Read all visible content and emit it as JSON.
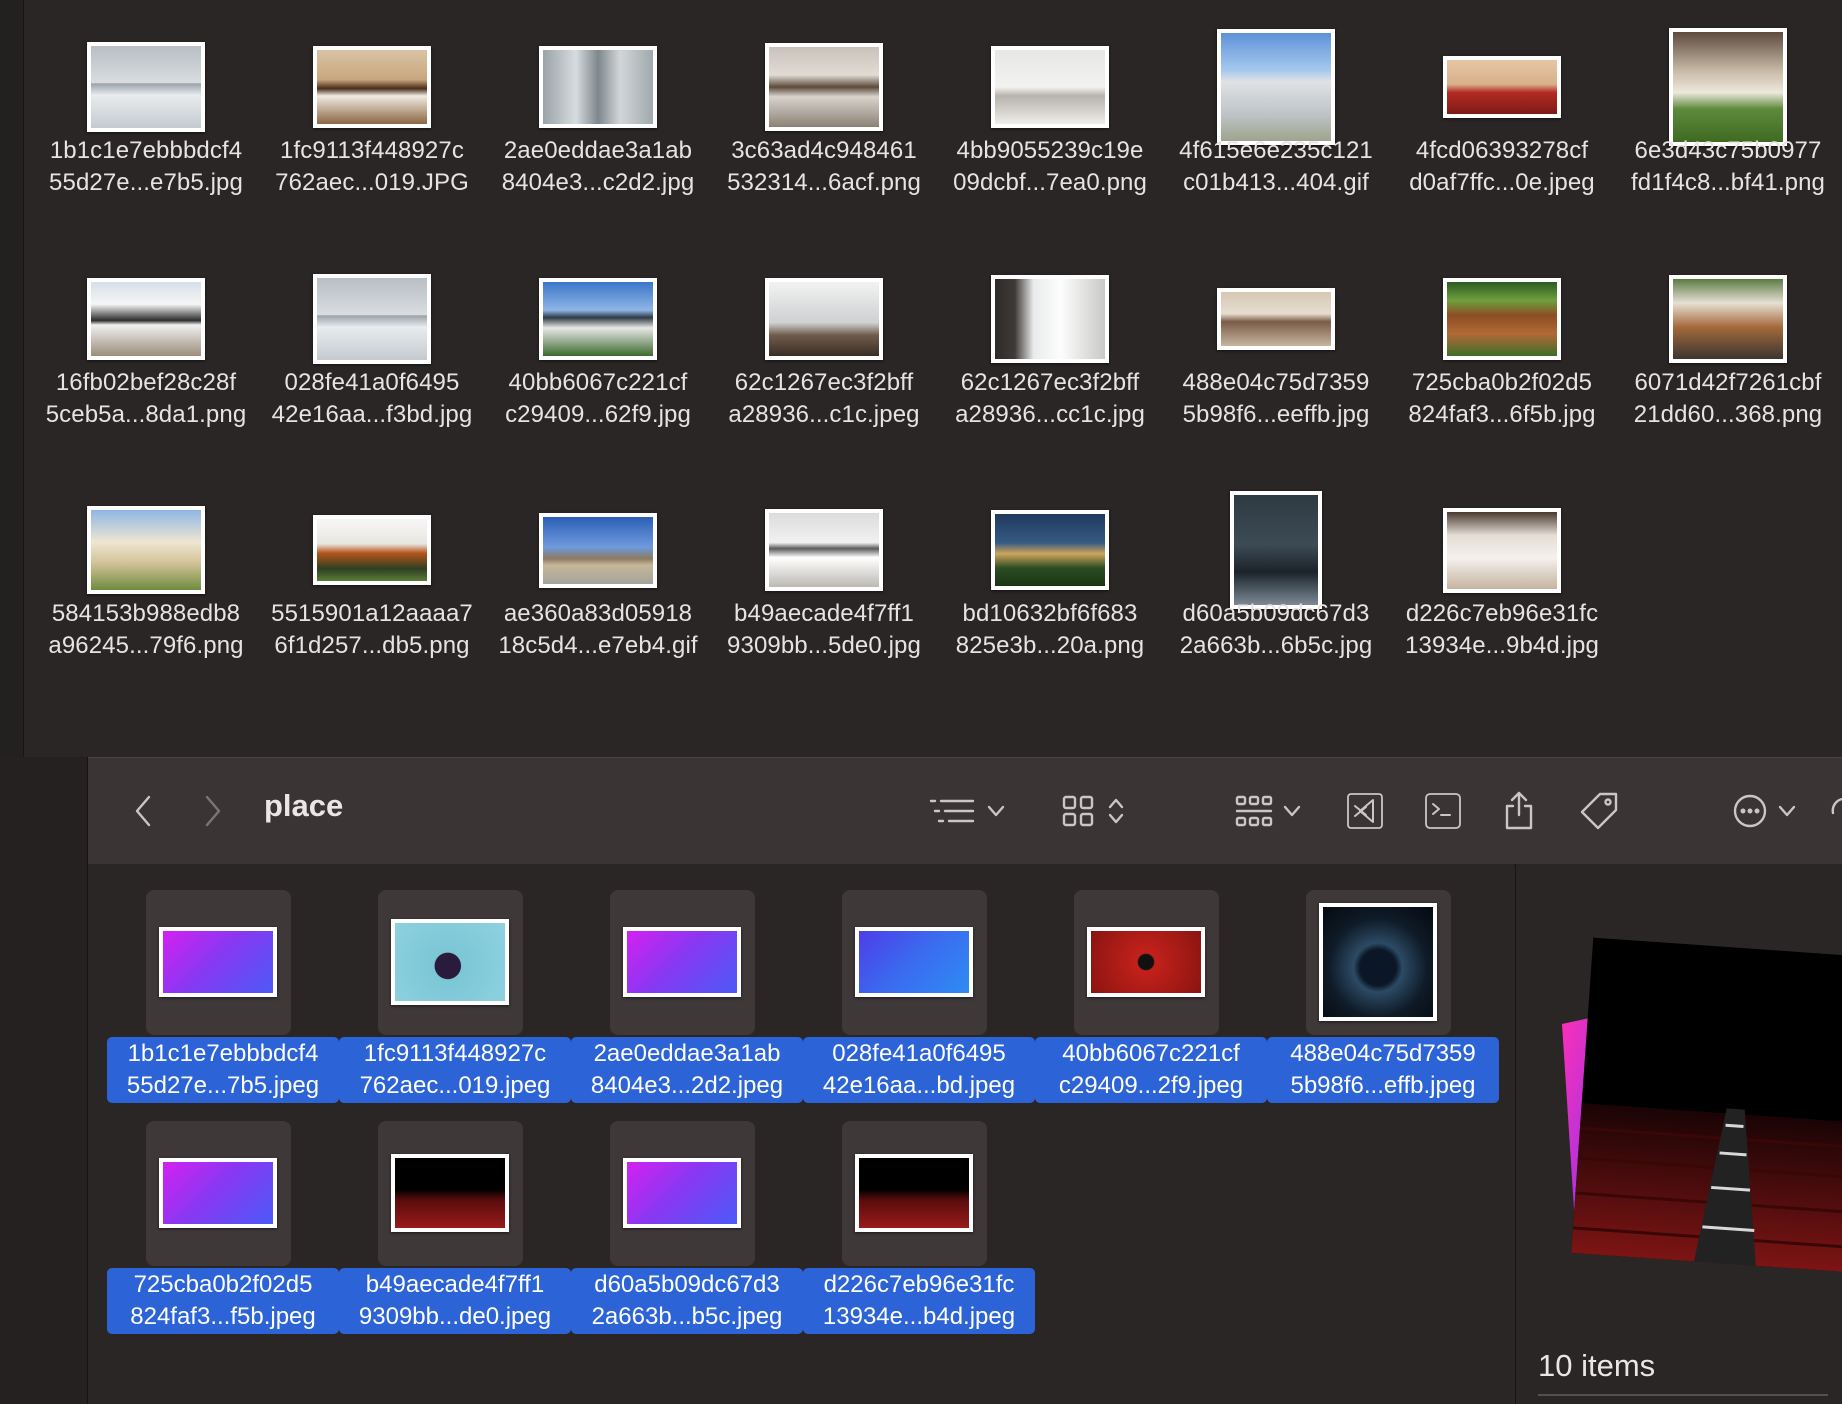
{
  "top_grid": {
    "items": [
      {
        "line1": "1b1c1e7ebbbdcf4",
        "line2": "55d27e...e7b5.jpg",
        "pic": "bedroom-gray"
      },
      {
        "line1": "1fc9113f448927c",
        "line2": "762aec...019.JPG",
        "pic": "bedroom-warm"
      },
      {
        "line1": "2ae0eddae3a1ab",
        "line2": "8404e3...c2d2.jpg",
        "pic": "bunk-room"
      },
      {
        "line1": "3c63ad4c948461",
        "line2": "532314...6acf.png",
        "pic": "living-room"
      },
      {
        "line1": "4bb9055239c19e",
        "line2": "09dcbf...7ea0.png",
        "pic": "living-white"
      },
      {
        "line1": "4f615e6e235c121",
        "line2": "c01b413...404.gif",
        "pic": "house-sky"
      },
      {
        "line1": "4fcd06393278cf",
        "line2": "d0af7ffc...0e.jpeg",
        "pic": "red-room"
      },
      {
        "line1": "6e3d43c75b0977",
        "line2": "fd1f4c8...bf41.png",
        "pic": "for-rent"
      },
      {
        "line1": "16fb02bef28c28f",
        "line2": "5ceb5a...8da1.png",
        "pic": "modern-white"
      },
      {
        "line1": "028fe41a0f6495",
        "line2": "42e16aa...f3bd.jpg",
        "pic": "bedroom-gray"
      },
      {
        "line1": "40bb6067c221cf",
        "line2": "c29409...62f9.jpg",
        "pic": "bungalow"
      },
      {
        "line1": "62c1267ec3f2bff",
        "line2": "a28936...c1c.jpeg",
        "pic": "bike-sky"
      },
      {
        "line1": "62c1267ec3f2bff",
        "line2": "a28936...cc1c.jpg",
        "pic": "bedroom-window"
      },
      {
        "line1": "488e04c75d7359",
        "line2": "5b98f6...eeffb.jpg",
        "pic": "kids-room"
      },
      {
        "line1": "725cba0b2f02d5",
        "line2": "824faf3...6f5b.jpg",
        "pic": "cabin"
      },
      {
        "line1": "6071d42f7261cbf",
        "line2": "21dd60...368.png",
        "pic": "porch"
      },
      {
        "line1": "584153b988edb8",
        "line2": "a96245...79f6.png",
        "pic": "villa"
      },
      {
        "line1": "5515901a12aaaa7",
        "line2": "6f1d257...db5.png",
        "pic": "modern-house"
      },
      {
        "line1": "ae360a83d05918",
        "line2": "18c5d4...e7eb4.gif",
        "pic": "ranch"
      },
      {
        "line1": "b49aecade4f7ff1",
        "line2": "9309bb...5de0.jpg",
        "pic": "bedroom-bright"
      },
      {
        "line1": "bd10632bf6f683",
        "line2": "825e3b...20a.png",
        "pic": "mansion-night"
      },
      {
        "line1": "d60a5b09dc67d3",
        "line2": "2a663b...6b5c.jpg",
        "pic": "dark-bunk"
      },
      {
        "line1": "d226c7eb96e31fc",
        "line2": "13934e...9b4d.jpg",
        "pic": "loft-room"
      }
    ]
  },
  "toolbar": {
    "folder_title": "place",
    "back_icon": "chevron-left-icon",
    "forward_icon": "chevron-right-icon"
  },
  "bottom_grid": {
    "items": [
      {
        "line1": "1b1c1e7ebbbdcf4",
        "line2": "55d27e...7b5.jpeg",
        "pic": "gradient-purple"
      },
      {
        "line1": "1fc9113f448927c",
        "line2": "762aec...019.jpeg",
        "pic": "laptop-teal"
      },
      {
        "line1": "2ae0eddae3a1ab",
        "line2": "8404e3...2d2.jpeg",
        "pic": "gradient-purple"
      },
      {
        "line1": "028fe41a0f6495",
        "line2": "42e16aa...bd.jpeg",
        "pic": "gradient-blue"
      },
      {
        "line1": "40bb6067c221cf",
        "line2": "c29409...2f9.jpeg",
        "pic": "red-portrait"
      },
      {
        "line1": "488e04c75d7359",
        "line2": "5b98f6...effb.jpeg",
        "pic": "new-year"
      },
      {
        "line1": "725cba0b2f02d5",
        "line2": "824faf3...f5b.jpeg",
        "pic": "gradient-purple"
      },
      {
        "line1": "b49aecade4f7ff1",
        "line2": "9309bb...de0.jpeg",
        "pic": "theater"
      },
      {
        "line1": "d60a5b09dc67d3",
        "line2": "2a663b...b5c.jpeg",
        "pic": "gradient-purple"
      },
      {
        "line1": "d226c7eb96e31fc",
        "line2": "13934e...b4d.jpeg",
        "pic": "theater"
      }
    ]
  },
  "preview": {
    "items_count": "10 items"
  }
}
